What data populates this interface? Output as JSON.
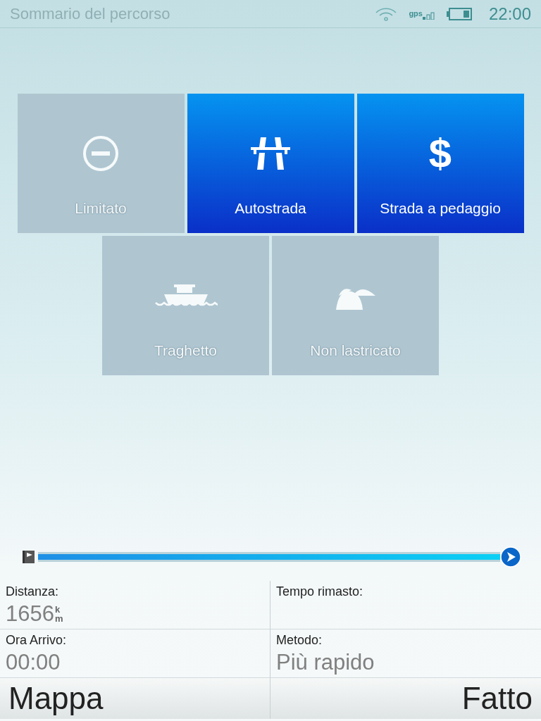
{
  "status_bar": {
    "title": "Sommario del percorso",
    "gps_label": "gps",
    "time": "22:00"
  },
  "options": [
    {
      "kind": "restricted",
      "label": "Limitato",
      "selected": false
    },
    {
      "kind": "motorway",
      "label": "Autostrada",
      "selected": true
    },
    {
      "kind": "toll",
      "label": "Strada a pedaggio",
      "symbol": "$",
      "selected": true
    },
    {
      "kind": "ferry",
      "label": "Traghetto",
      "selected": false
    },
    {
      "kind": "unpaved",
      "label": "Non lastricato",
      "selected": false
    }
  ],
  "route_progress": {
    "level": 1
  },
  "summary": [
    {
      "label": "Distanza:",
      "value": "1656",
      "unit_top": "k",
      "unit_bottom": "m"
    },
    {
      "label": "Tempo rimasto:"
    },
    {
      "label": "Ora Arrivo:",
      "value": "00:00"
    },
    {
      "label": "Metodo:",
      "value": "Più rapido"
    }
  ],
  "buttons": [
    {
      "label": "Mappa"
    },
    {
      "label": "Fatto"
    }
  ]
}
